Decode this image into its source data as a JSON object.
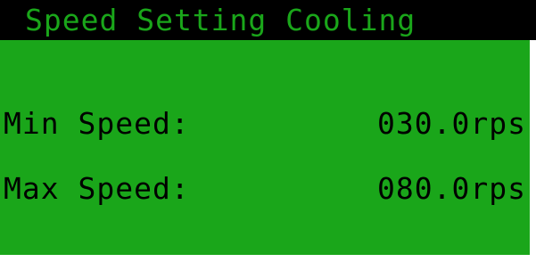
{
  "header": {
    "title": "Speed Setting Cooling"
  },
  "settings": [
    {
      "label": "Min Speed:",
      "value": "030.0rps"
    },
    {
      "label": "Max Speed:",
      "value": "080.0rps"
    }
  ],
  "colors": {
    "screen_background": "#1aa61a",
    "title_bar_background": "#000000",
    "title_text": "#1aa61a",
    "text": "#000000"
  }
}
